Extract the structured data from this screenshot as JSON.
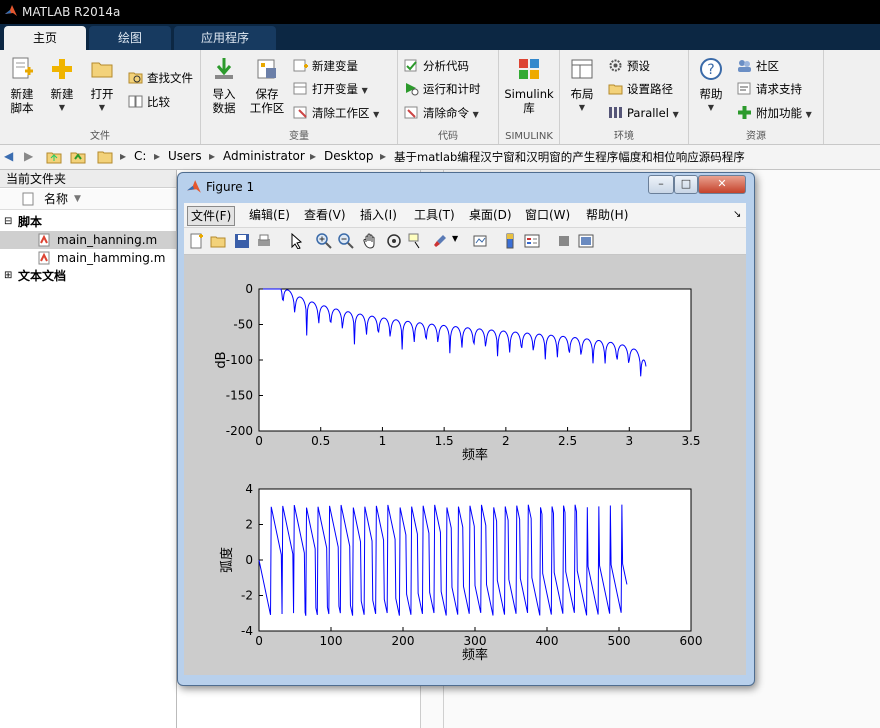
{
  "app": {
    "title": "MATLAB R2014a"
  },
  "tabs": [
    {
      "label": "主页",
      "active": true
    },
    {
      "label": "绘图",
      "active": false
    },
    {
      "label": "应用程序",
      "active": false
    }
  ],
  "ribbon": {
    "file": {
      "group_label": "文件",
      "new_script": "新建\n脚本",
      "new_script_l1": "新建",
      "new_script_l2": "脚本",
      "new": "新建",
      "open": "打开",
      "find_files": "查找文件",
      "compare": "比较"
    },
    "variable": {
      "group_label": "变量",
      "import_l1": "导入",
      "import_l2": "数据",
      "save_l1": "保存",
      "save_l2": "工作区",
      "new_var": "新建变量",
      "open_var": "打开变量",
      "clear_ws": "清除工作区"
    },
    "code": {
      "group_label": "代码",
      "analyze": "分析代码",
      "run_time": "运行和计时",
      "clear_cmd": "清除命令"
    },
    "simulink": {
      "group_label": "SIMULINK",
      "l1": "Simulink",
      "l2": "库"
    },
    "env": {
      "group_label": "环境",
      "layout": "布局",
      "prefs": "预设",
      "set_path": "设置路径",
      "parallel": "Parallel"
    },
    "resources": {
      "group_label": "资源",
      "help": "帮助",
      "community": "社区",
      "support": "请求支持",
      "addons": "附加功能"
    }
  },
  "address": {
    "crumbs": [
      "C:",
      "Users",
      "Administrator",
      "Desktop",
      "基于matlab编程汉宁窗和汉明窗的产生程序幅度和相位响应源码程序"
    ]
  },
  "current_folder": {
    "title": "当前文件夹",
    "column": "名称",
    "groups": [
      {
        "label": "脚本",
        "expanded": true,
        "files": [
          "main_hanning.m",
          "main_hamming.m"
        ]
      },
      {
        "label": "文本文档",
        "expanded": false,
        "files": []
      }
    ]
  },
  "figure": {
    "title": "Figure 1",
    "menu": [
      "文件(F)",
      "编辑(E)",
      "查看(V)",
      "插入(I)",
      "工具(T)",
      "桌面(D)",
      "窗口(W)",
      "帮助(H)"
    ],
    "plots": [
      {
        "xlabel": "频率",
        "ylabel": "dB",
        "xticks": [
          "0",
          "0.5",
          "1",
          "1.5",
          "2",
          "2.5",
          "3",
          "3.5"
        ],
        "yticks": [
          "0",
          "-50",
          "-100",
          "-150",
          "-200"
        ],
        "xlim": [
          0,
          3.5
        ],
        "ylim": [
          -200,
          0
        ]
      },
      {
        "xlabel": "频率",
        "ylabel": "弧度",
        "xticks": [
          "0",
          "100",
          "200",
          "300",
          "400",
          "500",
          "600"
        ],
        "yticks": [
          "4",
          "2",
          "0",
          "-2",
          "-4"
        ],
        "xlim": [
          0,
          600
        ],
        "ylim": [
          -4,
          4
        ]
      }
    ]
  },
  "colors": {
    "line": "#0000ff",
    "titlebar": "#000000",
    "tabbar": "#0c2743",
    "ribbon": "#f0f0f0"
  }
}
